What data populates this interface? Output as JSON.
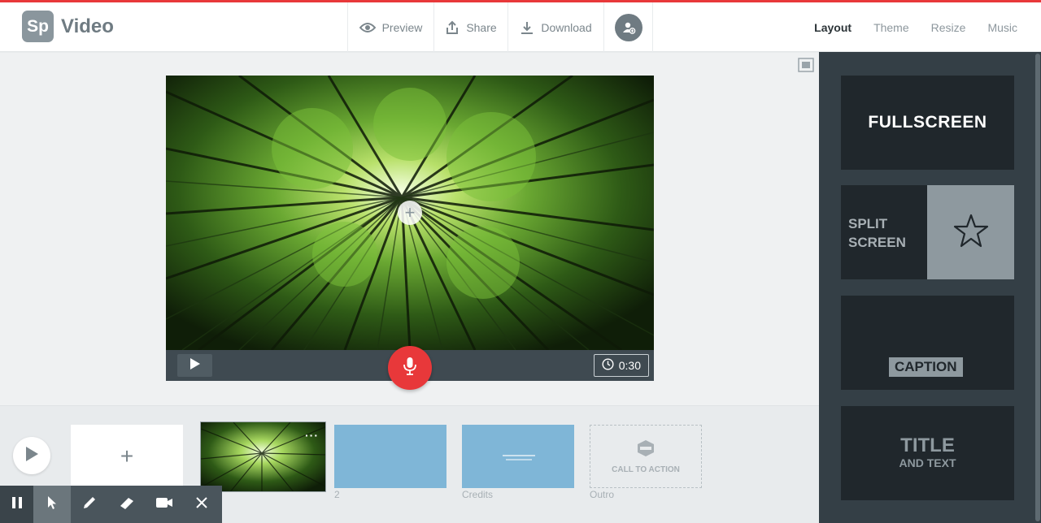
{
  "header": {
    "logo_badge": "Sp",
    "app_name": "Video",
    "preview_label": "Preview",
    "share_label": "Share",
    "download_label": "Download"
  },
  "tabs": [
    {
      "label": "Layout",
      "active": true
    },
    {
      "label": "Theme",
      "active": false
    },
    {
      "label": "Resize",
      "active": false
    },
    {
      "label": "Music",
      "active": false
    }
  ],
  "player": {
    "duration": "0:30"
  },
  "timeline": {
    "slides": [
      {
        "caption": "2"
      },
      {
        "caption": "Credits"
      },
      {
        "caption": "Outro",
        "label": "CALL TO ACTION"
      }
    ]
  },
  "layouts": {
    "fullscreen": "FULLSCREEN",
    "split_line1": "SPLIT",
    "split_line2": "SCREEN",
    "caption": "CAPTION",
    "title_line1": "TITLE",
    "title_line2": "AND TEXT"
  },
  "colors": {
    "accent_red": "#e8383a",
    "panel_bg": "#343f46",
    "slide_blue": "#7fb6d7"
  },
  "icons": [
    "eye-icon",
    "share-icon",
    "download-icon",
    "add-user-icon",
    "fit-screen-icon",
    "play-icon",
    "clock-icon",
    "microphone-icon",
    "pause-icon",
    "pointer-icon",
    "pencil-icon",
    "eraser-icon",
    "video-camera-icon",
    "close-icon",
    "star-icon",
    "badge-icon"
  ]
}
